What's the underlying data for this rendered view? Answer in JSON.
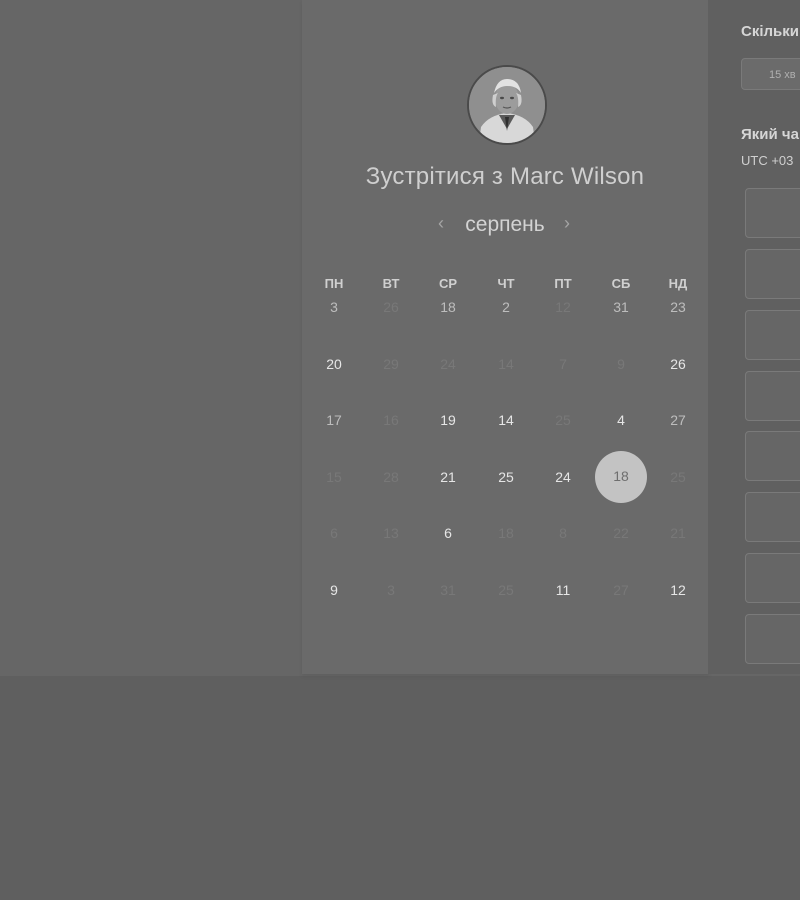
{
  "card": {
    "host_name": "Marc Wilson",
    "title": "Зустрітися з Marc Wilson"
  },
  "calendar": {
    "month": "серпень",
    "prev_icon": "‹",
    "next_icon": "›",
    "weekdays": [
      "ПН",
      "ВТ",
      "СР",
      "ЧТ",
      "ПТ",
      "СБ",
      "НД"
    ],
    "weeks": [
      [
        {
          "n": "3",
          "s": "dim"
        },
        {
          "n": "26",
          "s": "muted"
        },
        {
          "n": "18",
          "s": "dim"
        },
        {
          "n": "2",
          "s": "dim"
        },
        {
          "n": "12",
          "s": "muted"
        },
        {
          "n": "31",
          "s": "dim"
        },
        {
          "n": "23",
          "s": "dim"
        }
      ],
      [
        {
          "n": "20",
          "s": "active"
        },
        {
          "n": "29",
          "s": "muted"
        },
        {
          "n": "24",
          "s": "muted"
        },
        {
          "n": "14",
          "s": "muted"
        },
        {
          "n": "7",
          "s": "muted"
        },
        {
          "n": "9",
          "s": "muted"
        },
        {
          "n": "26",
          "s": "active"
        }
      ],
      [
        {
          "n": "17",
          "s": "dim"
        },
        {
          "n": "16",
          "s": "muted"
        },
        {
          "n": "19",
          "s": "active"
        },
        {
          "n": "14",
          "s": "active"
        },
        {
          "n": "25",
          "s": "muted"
        },
        {
          "n": "4",
          "s": "active"
        },
        {
          "n": "27",
          "s": "dim"
        }
      ],
      [
        {
          "n": "15",
          "s": "muted"
        },
        {
          "n": "28",
          "s": "muted"
        },
        {
          "n": "21",
          "s": "active"
        },
        {
          "n": "25",
          "s": "active"
        },
        {
          "n": "24",
          "s": "active"
        },
        {
          "n": "18",
          "s": "selected"
        },
        {
          "n": "25",
          "s": "muted"
        }
      ],
      [
        {
          "n": "6",
          "s": "muted"
        },
        {
          "n": "13",
          "s": "muted"
        },
        {
          "n": "6",
          "s": "active"
        },
        {
          "n": "18",
          "s": "muted"
        },
        {
          "n": "8",
          "s": "muted"
        },
        {
          "n": "22",
          "s": "muted"
        },
        {
          "n": "21",
          "s": "muted"
        }
      ],
      [
        {
          "n": "9",
          "s": "active"
        },
        {
          "n": "3",
          "s": "muted"
        },
        {
          "n": "31",
          "s": "muted"
        },
        {
          "n": "25",
          "s": "muted"
        },
        {
          "n": "11",
          "s": "active"
        },
        {
          "n": "27",
          "s": "muted"
        },
        {
          "n": "12",
          "s": "active"
        }
      ]
    ]
  },
  "booking": {
    "duration_label": "Скільки",
    "duration_value": "15 хв",
    "time_label": "Який ча",
    "timezone": "UTC +03"
  },
  "colors": {
    "selected_day_bg": "#c3c3c3",
    "card_bg": "#6a6a6a"
  }
}
